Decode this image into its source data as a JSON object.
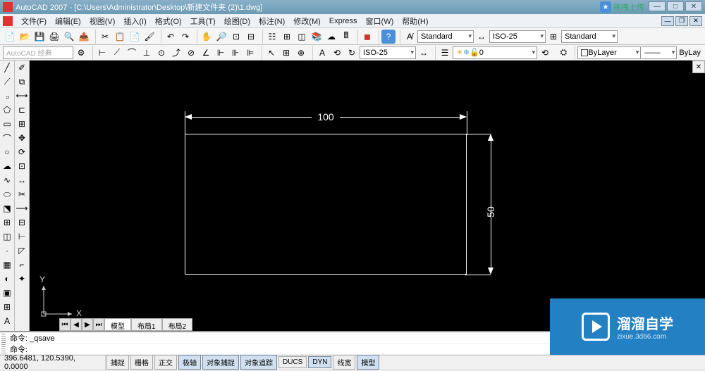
{
  "title": "AutoCAD 2007 - [C:\\Users\\Administrator\\Desktop\\新建文件夹 (2)\\1.dwg]",
  "upload_btn": "拖拽上传",
  "menu": [
    "文件(F)",
    "编辑(E)",
    "视图(V)",
    "插入(I)",
    "格式(O)",
    "工具(T)",
    "绘图(D)",
    "标注(N)",
    "修改(M)",
    "Express",
    "窗口(W)",
    "帮助(H)"
  ],
  "toolbar1": {
    "style_combo": "Standard",
    "iso_combo": "ISO-25",
    "standard2": "Standard"
  },
  "toolbar2": {
    "search_placeholder": "AutoCAD 经典",
    "iso": "ISO-25",
    "layer": "0",
    "bylayer": "ByLayer",
    "bylay_right": "ByLay"
  },
  "drawing": {
    "dim_h": "100",
    "dim_v": "50",
    "ucs_x": "X",
    "ucs_y": "Y"
  },
  "tabs": [
    "模型",
    "布局1",
    "布局2"
  ],
  "command": {
    "line1": "命令: _qsave",
    "line2": "命令:"
  },
  "status": {
    "coords": "396.6481, 120.5390, 0.0000",
    "buttons": [
      "捕捉",
      "栅格",
      "正交",
      "极轴",
      "对象捕捉",
      "对象追踪",
      "DUCS",
      "DYN",
      "线宽",
      "模型"
    ]
  },
  "watermark": {
    "main": "溜溜自学",
    "sub": "zixue.3d66.com"
  }
}
